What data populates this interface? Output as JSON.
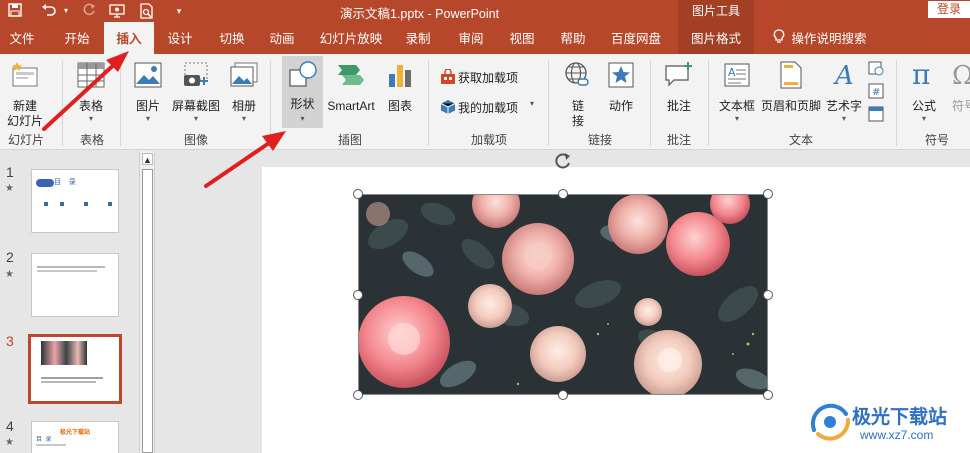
{
  "titlebar": {
    "document_title": "演示文稿1.pptx  -  PowerPoint",
    "context_tool_group": "图片工具",
    "login": "登录",
    "quick_access": [
      "save-icon",
      "undo-icon",
      "redo-icon",
      "present-icon",
      "preview-icon",
      "customize-icon"
    ]
  },
  "tabs": [
    {
      "label": "文件"
    },
    {
      "label": "开始"
    },
    {
      "label": "插入"
    },
    {
      "label": "设计"
    },
    {
      "label": "切换"
    },
    {
      "label": "动画"
    },
    {
      "label": "幻灯片放映"
    },
    {
      "label": "录制"
    },
    {
      "label": "审阅"
    },
    {
      "label": "视图"
    },
    {
      "label": "帮助"
    },
    {
      "label": "百度网盘"
    },
    {
      "label": "图片格式"
    }
  ],
  "active_tab": "插入",
  "tell_me": "操作说明搜索",
  "ribbon": {
    "new_slide": [
      "新建",
      "幻灯片"
    ],
    "table": "表格",
    "picture": "图片",
    "screenshot": "屏幕截图",
    "album": "相册",
    "shapes": "形状",
    "smartart": "SmartArt",
    "chart": "图表",
    "get_addins": "获取加载项",
    "my_addins": "我的加载项",
    "link": [
      "链",
      "接"
    ],
    "action": "动作",
    "comment": "批注",
    "textbox": "文本框",
    "header_footer": "页眉和页脚",
    "wordart": "艺术字",
    "equation": "公式",
    "symbol": "符号",
    "groups": {
      "slides": "幻灯片",
      "tables": "表格",
      "images": "图像",
      "illustrations": "插图",
      "addins": "加载项",
      "links": "链接",
      "comments": "批注",
      "text": "文本",
      "symbols": "符号"
    }
  },
  "slides": [
    {
      "number": "1",
      "title": "目    录",
      "current": false
    },
    {
      "number": "2",
      "current": false
    },
    {
      "number": "3",
      "current": true
    },
    {
      "number": "4",
      "title": "极光下载站",
      "subtitle": "目  录",
      "current": false
    }
  ],
  "watermark": {
    "name": "极光下载站",
    "url": "www.xz7.com"
  },
  "colors": {
    "accent": "#b7472a",
    "selected_slide": "#c0462b",
    "arrow": "#e02020"
  }
}
